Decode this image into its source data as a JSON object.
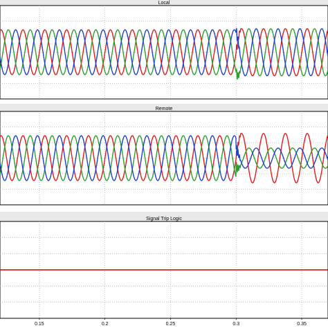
{
  "chart_data": [
    {
      "type": "line",
      "title": "Local",
      "xlim": [
        0.12,
        0.37
      ],
      "grid": true,
      "series": [
        {
          "color": "#e41a1c",
          "amplitude_pre": 1.0,
          "amplitude_post": 1.05,
          "phase_deg": 0
        },
        {
          "color": "#2ca02c",
          "amplitude_pre": 1.0,
          "amplitude_post": 1.05,
          "phase_deg": -120
        },
        {
          "color": "#1f3fd1",
          "amplitude_pre": 1.0,
          "amplitude_post": 1.05,
          "phase_deg": 120
        }
      ],
      "frequency_hz": 60,
      "event_time": 0.3
    },
    {
      "type": "line",
      "title": "Remote",
      "xlim": [
        0.12,
        0.37
      ],
      "grid": true,
      "series": [
        {
          "color": "#e41a1c",
          "amplitude_pre": 1.0,
          "amplitude_post": 1.1,
          "phase_deg": 0
        },
        {
          "color": "#2ca02c",
          "amplitude_pre": 1.0,
          "amplitude_post": 0.45,
          "phase_deg": -120
        },
        {
          "color": "#1f3fd1",
          "amplitude_pre": 1.0,
          "amplitude_post": 0.45,
          "phase_deg": 120
        }
      ],
      "frequency_hz": 60,
      "event_time": 0.3
    },
    {
      "type": "line",
      "title": "Signal Trip Logic",
      "xlim": [
        0.12,
        0.37
      ],
      "grid": true,
      "series": [
        {
          "color": "#cc0000",
          "constant_value": 0
        }
      ]
    }
  ],
  "x_axis": {
    "ticks": [
      0.15,
      0.2,
      0.25,
      0.3,
      0.35
    ],
    "tick_labels": [
      "0.15",
      "0.2",
      "0.25",
      "0.3",
      "0.35"
    ]
  },
  "colors": {
    "panel_bg": "#ffffff",
    "title_bar": "#e8e8e8",
    "grid": "#b0b0b0",
    "frame": "#000000"
  }
}
